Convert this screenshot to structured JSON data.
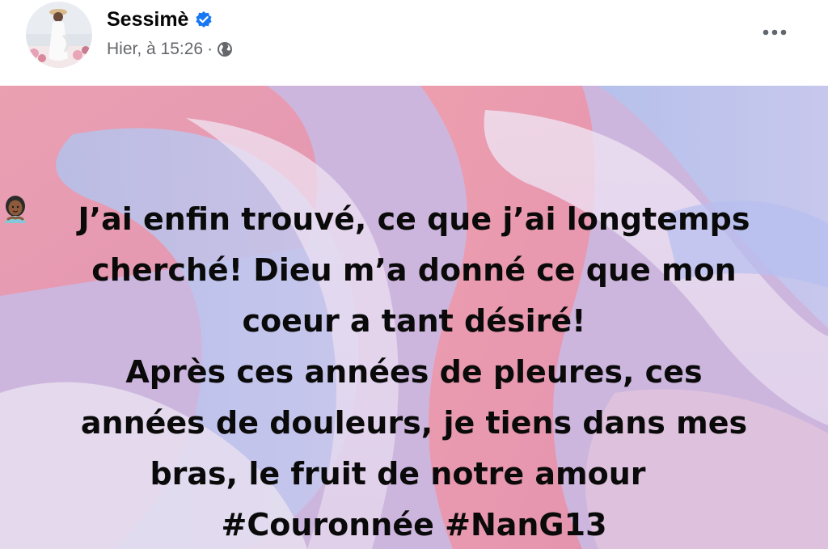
{
  "post": {
    "author": "Sessimè",
    "timestamp": "Hier, à 15:26",
    "separator": "·",
    "lines": [
      "J’ai enfin trouvé, ce que j’ai longtemps",
      "cherché! Dieu m’a donné ce que mon",
      "coeur a tant désiré!",
      "Après ces années de pleures, ces",
      "années de douleurs, je tiens dans mes",
      "bras, le fruit de notre amour",
      "#Couronnée #NanG13"
    ]
  },
  "icons": {
    "verified": "verified-badge-icon",
    "audience": "globe-icon",
    "more": "more-options-icon",
    "emoji": "woman-emoji-icon"
  },
  "colors": {
    "author_text": "#050505",
    "meta_text": "#65676b",
    "verified_blue": "#1877f2",
    "post_text": "#0a0a0a"
  }
}
